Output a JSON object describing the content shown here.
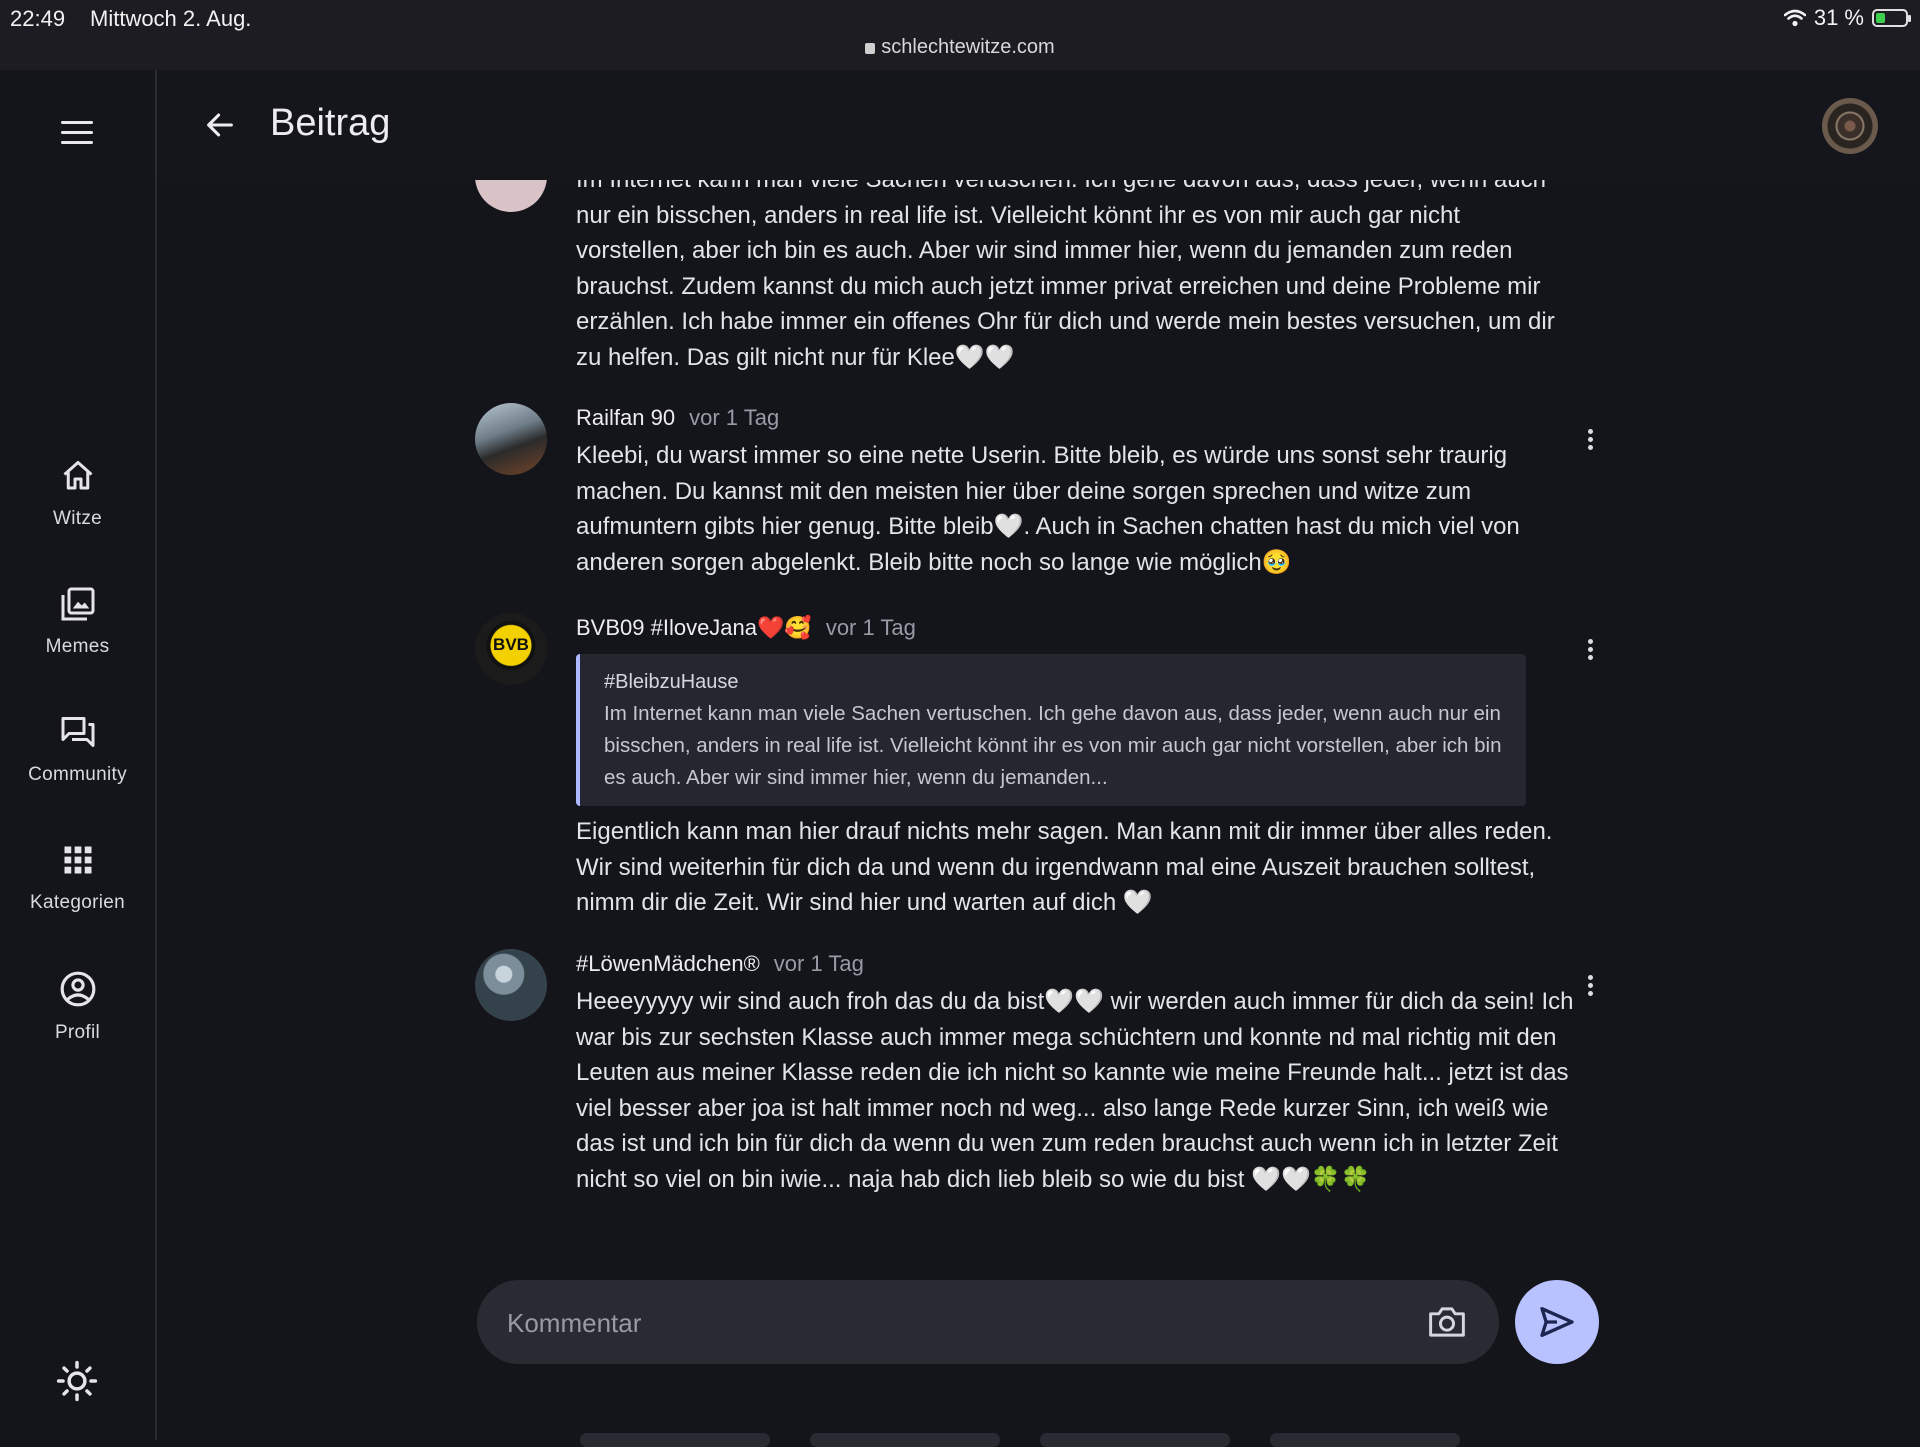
{
  "status_bar": {
    "time": "22:49",
    "date": "Mittwoch 2. Aug.",
    "url": "schlechtewitze.com",
    "battery": "31 %",
    "battery_level": 0.31
  },
  "sidebar": {
    "items": [
      {
        "label": "Witze",
        "icon": "home-icon"
      },
      {
        "label": "Memes",
        "icon": "image-gallery-icon"
      },
      {
        "label": "Community",
        "icon": "chat-icon"
      },
      {
        "label": "Kategorien",
        "icon": "grid-icon"
      },
      {
        "label": "Profil",
        "icon": "account-icon"
      }
    ]
  },
  "header": {
    "title": "Beitrag"
  },
  "comments": {
    "partial": {
      "text": "Im Internet kann man viele Sachen vertuschen. Ich gehe davon aus, dass jeder, wenn auch nur ein bisschen, anders in real life ist. Vielleicht könnt ihr es von mir auch gar nicht vorstellen, aber ich bin es auch. Aber wir sind immer hier, wenn du jemanden zum reden brauchst. Zudem kannst du mich auch jetzt immer privat erreichen und deine Probleme mir erzählen. Ich habe immer ein offenes Ohr für dich und werde mein bestes versuchen, um dir zu helfen. Das gilt nicht nur für Klee🤍🤍"
    },
    "railfan": {
      "author": "Railfan 90",
      "time": "vor 1 Tag",
      "text": "Kleebi, du warst immer so eine nette Userin. Bitte bleib, es würde uns sonst sehr traurig machen. Du kannst mit den meisten hier über deine sorgen sprechen und witze zum aufmuntern gibts hier genug. Bitte bleib🤍. Auch in Sachen chatten hast du mich viel von anderen sorgen abgelenkt. Bleib bitte noch so lange wie möglich🥹"
    },
    "bvb": {
      "author": "BVB09 #IloveJana❤️🥰",
      "time": "vor 1 Tag",
      "avatar_text": "BVB",
      "quote_title": "#BleibzuHause",
      "quote_text": "Im Internet kann man viele Sachen vertuschen. Ich gehe davon aus, dass jeder, wenn auch nur ein bisschen, anders in real life ist. Vielleicht könnt ihr es von mir auch gar nicht vorstellen, aber ich bin es auch. Aber wir sind immer hier, wenn du jemanden...",
      "text": "Eigentlich kann man hier drauf nichts mehr sagen. Man kann mit dir immer über alles reden. Wir sind weiterhin für dich da und wenn du irgendwann mal eine Auszeit brauchen solltest, nimm dir die Zeit. Wir sind hier und warten auf dich 🤍"
    },
    "loewe": {
      "author": "#LöwenMädchen®",
      "time": "vor 1 Tag",
      "text": "Heeeyyyyy wir sind auch froh das du da bist🤍🤍 wir werden auch immer für dich da sein! Ich war bis zur sechsten Klasse auch immer mega schüchtern und konnte nd mal richtig mit den Leuten aus meiner Klasse reden die ich nicht so kannte wie meine Freunde halt... jetzt ist das viel besser aber joa ist halt immer noch nd weg... also lange Rede kurzer Sinn, ich weiß wie das ist und ich bin für dich da wenn du wen zum reden brauchst auch wenn ich in letzter Zeit nicht so viel on bin iwie... naja hab dich lieb bleib so wie du bist 🤍🤍🍀🍀"
    }
  },
  "comment_input": {
    "placeholder": "Kommentar"
  },
  "colors": {
    "background": "#14141b",
    "accent": "#b8c2ff",
    "quote_border": "#aeb8ff"
  }
}
